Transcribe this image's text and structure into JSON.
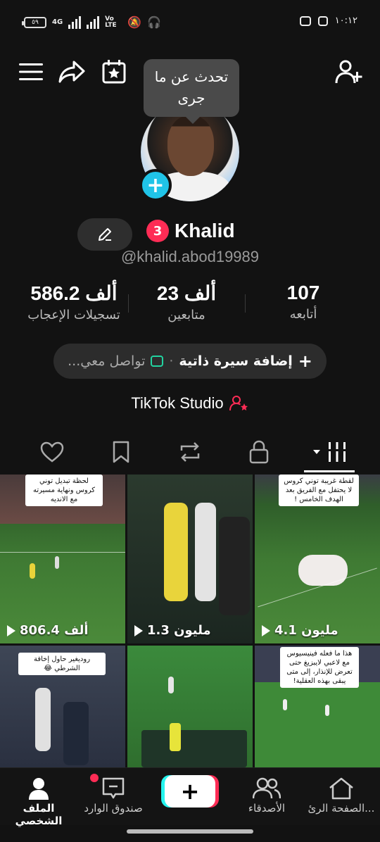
{
  "status": {
    "battery": "٥٩",
    "network": "4G",
    "volte": "Vo LTE",
    "time": "١٠:١٢"
  },
  "tooltip": "تحدث عن ما جرى",
  "profile": {
    "notification_badge": "3",
    "name": "Khalid",
    "username": "@khalid.abod19989"
  },
  "stats": [
    {
      "value": "107",
      "label": "أتابعه"
    },
    {
      "value": "23 ألف",
      "label": "متابعين"
    },
    {
      "value": "586.2 ألف",
      "label": "تسجيلات الإعجاب"
    }
  ],
  "bio": {
    "add_label": "إضافة سيرة ذاتية",
    "separator": "·",
    "contact_label": "تواصل معي..."
  },
  "studio_label": "TikTok Studio",
  "icons": {
    "menu": "menu-icon",
    "share": "share-icon",
    "calendar": "calendar-star-icon",
    "add_user": "add-user-icon"
  },
  "videos": [
    {
      "caption": "لحظة تبديل توني كروس ونهاية مسيرته مع الانديه",
      "views": "806.4 ألف"
    },
    {
      "caption": "",
      "views": "1.3 مليون"
    },
    {
      "caption": "لقطة غريبة توني كروس لا يحتفل مع الفريق بعد الهدف الخامس !",
      "views": "4.1 مليون"
    },
    {
      "caption": "روديغير حاول إخافة الشرطي 😂",
      "views": ""
    },
    {
      "caption": "",
      "views": ""
    },
    {
      "caption": "هذا ما فعله فينيسيوس مع لاعبي لايبزيغ حتى تعرض للإنذار، إلى متى يبقى بهذه العقلية!",
      "views": ""
    }
  ],
  "nav": {
    "profile": "الملف الشخصي",
    "inbox": "صندوق الوارد",
    "create": "+",
    "friends": "الأصدقاء",
    "home": "الصفحة الرئ..."
  },
  "colors": {
    "accent_red": "#fe2c55",
    "accent_cyan": "#25f4ee",
    "avatar_plus": "#20c4e8",
    "background": "#121212"
  }
}
